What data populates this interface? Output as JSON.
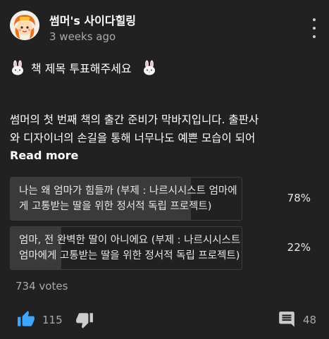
{
  "post": {
    "author": "썸머's 사이다힐링",
    "time": "3 weeks ago",
    "title": "책 제목 투표해주세요",
    "body_lines": [
      "썸머의 첫 번째 책의 출간 준비가 막바지입니다. 출판사",
      "와 디자이너의 손길을 통해 너무나도 예쁜 모습이 되어"
    ],
    "read_more": "Read more"
  },
  "poll": {
    "options": [
      {
        "lines": [
          "나는 왜 엄마가 힘들까 (부제 : 나르시시스트 엄마에",
          "게 고통받는 딸을 위한 정서적 독립 프로젝트)"
        ],
        "percent_label": "78%",
        "percent": 78
      },
      {
        "lines": [
          "엄마, 전 완벽한 딸이 아니에요 (부제 : 나르시시스트",
          "엄마에게 고통받는 딸을 위한 정서적 독립 프로젝트)"
        ],
        "percent_label": "22%",
        "percent": 22
      }
    ],
    "votes": "734 votes"
  },
  "actions": {
    "likes": "115",
    "comments": "48"
  },
  "icons": {
    "avatar": "avatar-illustration",
    "menu": "more-vert-icon",
    "title_left": "bunny-emoji",
    "title_right": "bunny-emoji",
    "like": "thumb-up-icon",
    "dislike": "thumb-down-icon",
    "comment": "comment-icon"
  },
  "colors": {
    "background": "#212121",
    "like_active": "#3ea6ff",
    "secondary_text": "#aaaaaa",
    "poll_fill": "#3a3a3a"
  }
}
